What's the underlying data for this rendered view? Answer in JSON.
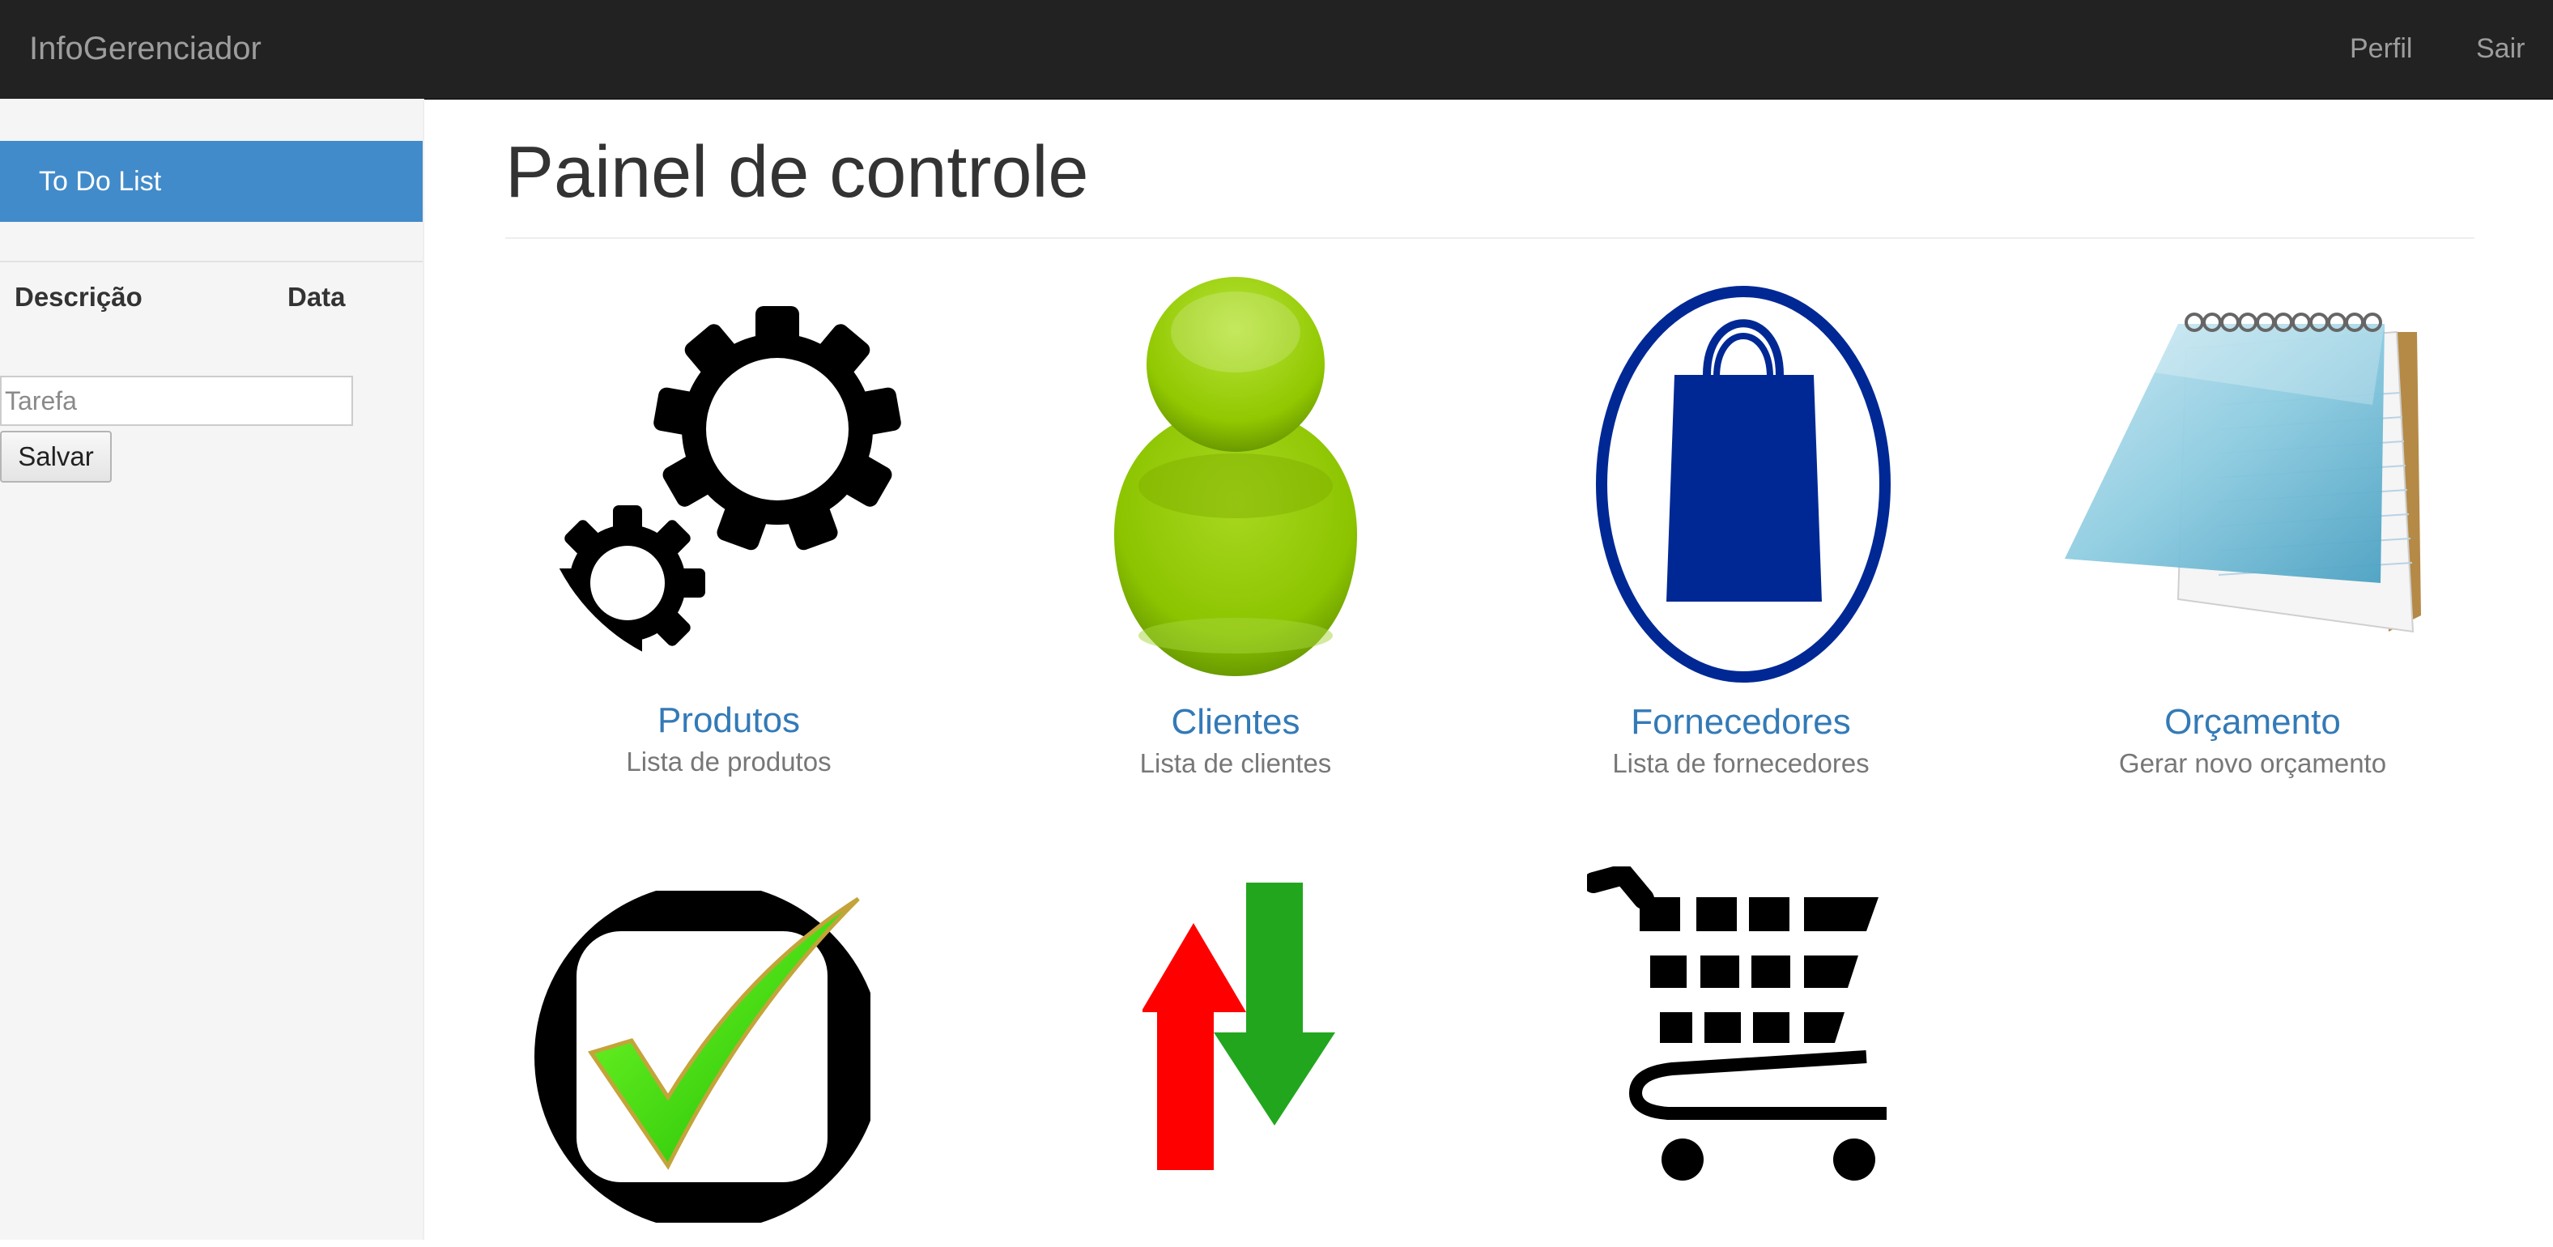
{
  "navbar": {
    "brand": "InfoGerenciador",
    "links": {
      "perfil": "Perfil",
      "sair": "Sair"
    }
  },
  "sidebar": {
    "header": "To Do List",
    "columns": {
      "descricao": "Descrição",
      "data": "Data"
    },
    "task_input": {
      "value": "",
      "placeholder": "Tarefa"
    },
    "save_label": "Salvar"
  },
  "main": {
    "title": "Painel de controle",
    "tiles": [
      {
        "title": "Produtos",
        "subtitle": "Lista de produtos",
        "icon": "gears-icon"
      },
      {
        "title": "Clientes",
        "subtitle": "Lista de clientes",
        "icon": "person-icon"
      },
      {
        "title": "Fornecedores",
        "subtitle": "Lista de fornecedores",
        "icon": "shopping-bag-icon"
      },
      {
        "title": "Orçamento",
        "subtitle": "Gerar novo orçamento",
        "icon": "notepad-icon"
      },
      {
        "title": "",
        "subtitle": "",
        "icon": "checkbox-icon"
      },
      {
        "title": "",
        "subtitle": "",
        "icon": "up-down-arrows-icon"
      },
      {
        "title": "",
        "subtitle": "",
        "icon": "shopping-cart-icon"
      }
    ]
  },
  "colors": {
    "navbar_bg": "#222222",
    "nav_text": "#9d9d9d",
    "sidebar_bg": "#f5f5f5",
    "todo_header_bg": "#428bca",
    "link_blue": "#337ab7",
    "muted_text": "#777777"
  }
}
